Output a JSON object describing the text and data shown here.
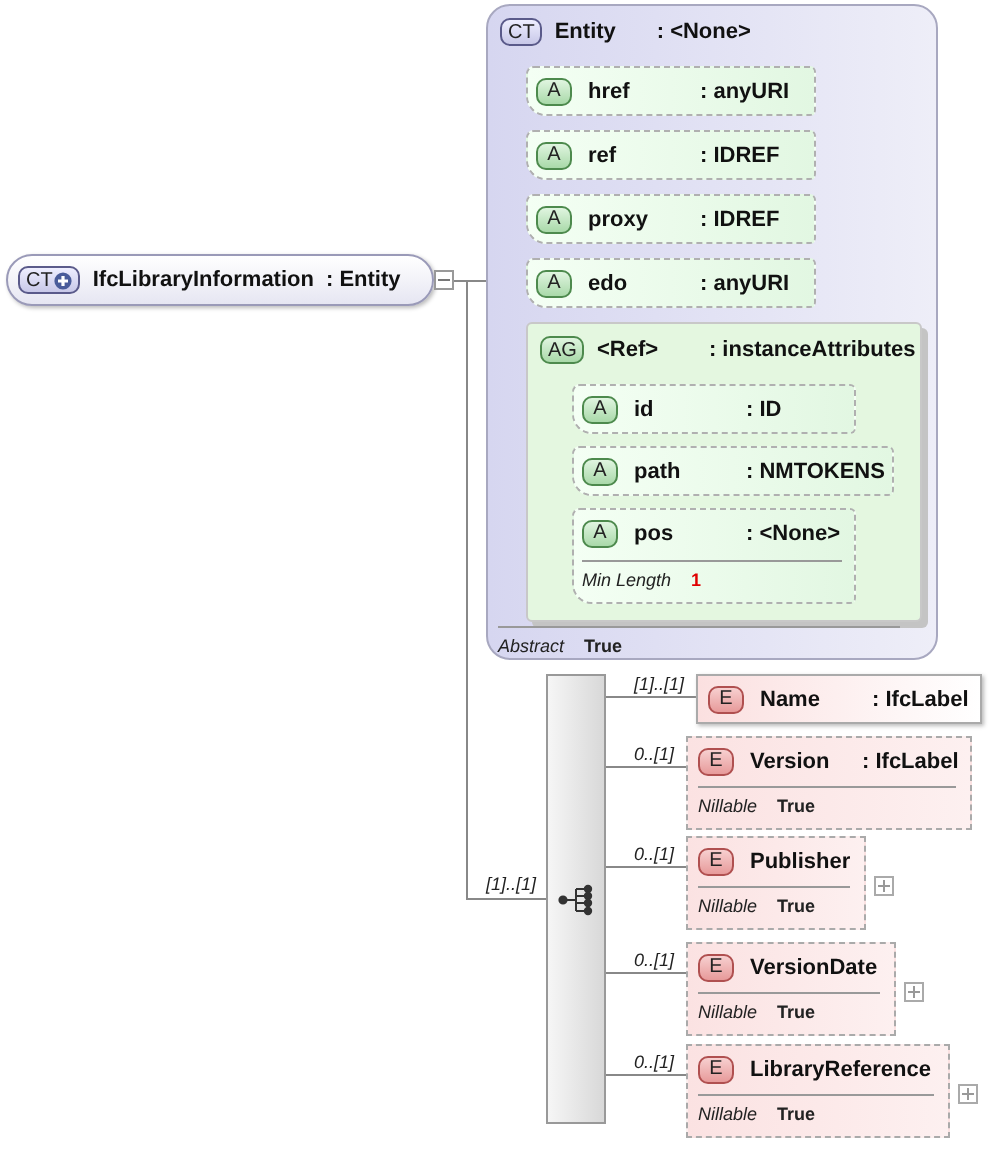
{
  "root": {
    "badge": "CT",
    "name": "IfcLibraryInformation",
    "type": ": Entity",
    "expanded": true
  },
  "complex_type": {
    "badge": "CT",
    "name": "Entity",
    "type": ": <None>",
    "attributes": [
      {
        "badge": "A",
        "name": "href",
        "type": ": anyURI"
      },
      {
        "badge": "A",
        "name": "ref",
        "type": ": IDREF"
      },
      {
        "badge": "A",
        "name": "proxy",
        "type": ": IDREF"
      },
      {
        "badge": "A",
        "name": "edo",
        "type": ": anyURI"
      }
    ],
    "attribute_group": {
      "badge": "AG",
      "name": "<Ref>",
      "type": ": instanceAttributes",
      "attributes": [
        {
          "badge": "A",
          "name": "id",
          "type": ": ID"
        },
        {
          "badge": "A",
          "name": "path",
          "type": ": NMTOKENS"
        },
        {
          "badge": "A",
          "name": "pos",
          "type": ": <None>",
          "facets": [
            {
              "label": "Min Length",
              "value": "1"
            }
          ]
        }
      ]
    },
    "properties": [
      {
        "label": "Abstract",
        "value": "True"
      }
    ]
  },
  "sequence": {
    "multiplicity": "[1]..[1]"
  },
  "elements": [
    {
      "badge": "E",
      "name": "Name",
      "type": ": IfcLabel",
      "multiplicity": "[1]..[1]",
      "optional": false,
      "expandable": false
    },
    {
      "badge": "E",
      "name": "Version",
      "type": ": IfcLabel",
      "multiplicity": "0..[1]",
      "optional": true,
      "expandable": false,
      "properties": [
        {
          "label": "Nillable",
          "value": "True"
        }
      ]
    },
    {
      "badge": "E",
      "name": "Publisher",
      "multiplicity": "0..[1]",
      "optional": true,
      "expandable": true,
      "properties": [
        {
          "label": "Nillable",
          "value": "True"
        }
      ]
    },
    {
      "badge": "E",
      "name": "VersionDate",
      "multiplicity": "0..[1]",
      "optional": true,
      "expandable": true,
      "properties": [
        {
          "label": "Nillable",
          "value": "True"
        }
      ]
    },
    {
      "badge": "E",
      "name": "LibraryReference",
      "multiplicity": "0..[1]",
      "optional": true,
      "expandable": true,
      "properties": [
        {
          "label": "Nillable",
          "value": "True"
        }
      ]
    }
  ]
}
